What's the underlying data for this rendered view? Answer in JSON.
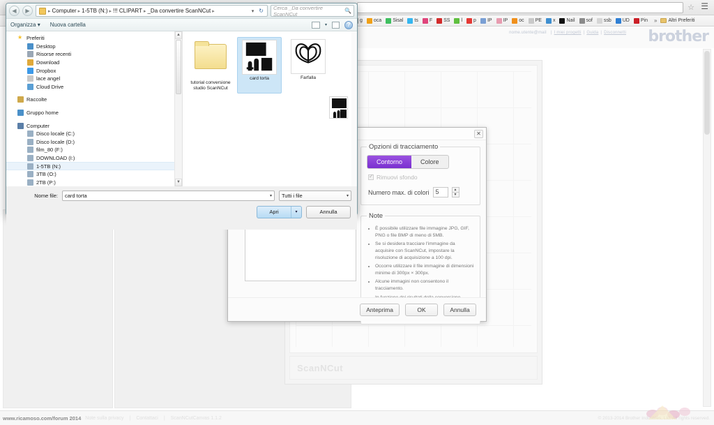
{
  "browser": {
    "omnibox_value": "",
    "star_icon": "star-icon",
    "menu_icon": "hamburger-menu-icon",
    "bookmarks": [
      {
        "label": "g",
        "color": "#9a9a9a"
      },
      {
        "label": "oca",
        "color": "#f0a017"
      },
      {
        "label": "Sisal",
        "color": "#3fbf5f"
      },
      {
        "label": "ts",
        "color": "#35b6ef"
      },
      {
        "label": "F",
        "color": "#e0457b"
      },
      {
        "label": "SS",
        "color": "#d22b2b"
      },
      {
        "label": "l",
        "color": "#5fbf3f"
      },
      {
        "label": "p",
        "color": "#e53935"
      },
      {
        "label": "IP",
        "color": "#7a9fd4"
      },
      {
        "label": "IP",
        "color": "#e89cb0"
      },
      {
        "label": "oc",
        "color": "#f0901c"
      },
      {
        "label": "PE",
        "color": "#c9c9c9"
      },
      {
        "label": "x",
        "color": "#3f8fd0"
      },
      {
        "label": "Nail",
        "color": "#111111"
      },
      {
        "label": "sof",
        "color": "#8a8a8a"
      },
      {
        "label": "ssb",
        "color": "#d6d6d6"
      },
      {
        "label": "UD",
        "color": "#2f7fd4"
      },
      {
        "label": "Pin",
        "color": "#cb1f27"
      }
    ],
    "bookmarks_overflow": "»",
    "other_bookmarks_label": "Altri Preferiti"
  },
  "webpage": {
    "header_links": [
      "I miei progetti",
      "Guida",
      "Disconnetti"
    ],
    "header_account": "nome.utente@mail",
    "logo_text": "brother",
    "canvas_watermark": "ScanNCut",
    "status_left": "www.ricamoso.com/forum 2014",
    "status_links": [
      "Note sulla privacy",
      "Contattaci",
      "ScanNCutCanvas 1.1.2"
    ],
    "status_right": "© 2013-2014 Brother Industries, Ltd. All rights reserved."
  },
  "trace_dialog": {
    "close_label": "✕",
    "options_group_title": "Opzioni di tracciamento",
    "tabs": [
      {
        "label": "Contorno",
        "active": true
      },
      {
        "label": "Colore",
        "active": false
      }
    ],
    "remove_background_label": "Rimuovi sfondo",
    "remove_background_checked": true,
    "max_colors_label": "Numero max. di colori",
    "max_colors_value": "5",
    "notes_title": "Note",
    "notes": [
      "È possibile utilizzare file immagine JPG, GIF, PNG o file BMP di meno di 5MB.",
      "Se si desidera tracciare l'immagine da acquisire con ScanNCut, impostare la risoluzione di acquisizione a 100 dpi.",
      "Occorre utilizzare il file immagine di dimensioni minime di 300px × 300px.",
      "Alcune immagini non consentono il tracciamento.",
      "In funzione dei risultati della conversione, potrebbe non essere possibile tagliare con ScanNCut."
    ],
    "buttons": [
      "Anteprima",
      "OK",
      "Annulla"
    ],
    "accent_color": "#7a2fd0"
  },
  "open_dialog": {
    "nav_back_icon": "back-arrow-icon",
    "nav_forward_icon": "forward-arrow-icon",
    "breadcrumbs": [
      "Computer",
      "1-5TB (N:)",
      "!!! CLIPART",
      "_Da convertire ScanNCut"
    ],
    "address_dropdown_icon": "chevron-down-icon",
    "refresh_icon": "refresh-icon",
    "search_placeholder": "Cerca _Da convertire ScanNCut",
    "search_icon": "search-icon",
    "toolbar": {
      "organize_label": "Organizza",
      "new_folder_label": "Nuova cartella",
      "view_icon": "view-layout-icon",
      "view_chevron_icon": "chevron-down-icon",
      "preview_pane_icon": "preview-pane-icon",
      "help_icon": "help-icon"
    },
    "tree": [
      {
        "label": "Preferiti",
        "icon": "star-icon",
        "color": "#f5c026",
        "level": 0
      },
      {
        "label": "Desktop",
        "icon": "desktop-icon",
        "color": "#4a90c9",
        "level": 1
      },
      {
        "label": "Risorse recenti",
        "icon": "recent-icon",
        "color": "#9aa7b5",
        "level": 1
      },
      {
        "label": "Download",
        "icon": "download-icon",
        "color": "#e0a93a",
        "level": 1
      },
      {
        "label": "Dropbox",
        "icon": "dropbox-icon",
        "color": "#3d9ae8",
        "level": 1
      },
      {
        "label": "lace angel",
        "icon": "folder-icon",
        "color": "#c8c8c8",
        "level": 1
      },
      {
        "label": "Cloud Drive",
        "icon": "cloud-icon",
        "color": "#5a9fd4",
        "level": 1
      },
      {
        "label": "Raccolte",
        "icon": "library-icon",
        "color": "#cfa94b",
        "level": 0
      },
      {
        "label": "Gruppo home",
        "icon": "homegroup-icon",
        "color": "#4a90c9",
        "level": 0
      },
      {
        "label": "Computer",
        "icon": "computer-icon",
        "color": "#5b7fa8",
        "level": 0
      },
      {
        "label": "Disco locale (C:)",
        "icon": "drive-icon",
        "color": "#9ab0c4",
        "level": 1
      },
      {
        "label": "Disco locale (D:)",
        "icon": "drive-icon",
        "color": "#9ab0c4",
        "level": 1
      },
      {
        "label": "film_80 (F:)",
        "icon": "drive-icon",
        "color": "#9ab0c4",
        "level": 1
      },
      {
        "label": "DOWNLOAD (I:)",
        "icon": "drive-icon",
        "color": "#9ab0c4",
        "level": 1
      },
      {
        "label": "1-5TB (N:)",
        "icon": "drive-icon",
        "color": "#9ab0c4",
        "level": 1,
        "selected": true
      },
      {
        "label": "3TB (O:)",
        "icon": "drive-icon",
        "color": "#9ab0c4",
        "level": 1
      },
      {
        "label": "2TB (P:)",
        "icon": "drive-icon",
        "color": "#9ab0c4",
        "level": 1
      }
    ],
    "files": [
      {
        "label": "tutorial conversione studio ScanNCut",
        "type": "folder",
        "selected": false
      },
      {
        "label": "card torta",
        "type": "image",
        "selected": true
      },
      {
        "label": "Farfalla",
        "type": "image",
        "selected": false
      }
    ],
    "filename_label": "Nome file:",
    "filename_value": "card torta",
    "filter_value": "Tutti i file",
    "filter_chevron_icon": "chevron-down-icon",
    "open_button_label": "Apri",
    "open_split_icon": "chevron-down-icon",
    "cancel_button_label": "Annulla"
  }
}
